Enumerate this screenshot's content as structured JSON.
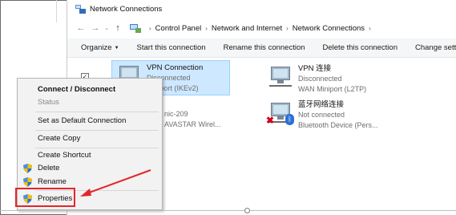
{
  "window": {
    "title": "Network Connections"
  },
  "address_bar": {
    "crumbs": [
      "Control Panel",
      "Network and Internet",
      "Network Connections"
    ]
  },
  "toolbar": {
    "organize": "Organize",
    "start": "Start this connection",
    "rename": "Rename this connection",
    "delete": "Delete this connection",
    "change": "Change settings"
  },
  "connections": [
    {
      "name": "VPN Connection",
      "status": "Disconnected",
      "device": "Miniport (IKEv2)"
    },
    {
      "name": "VPN 连接",
      "status": "Disconnected",
      "device": "WAN Miniport (L2TP)"
    },
    {
      "name": "",
      "status": "nic-209",
      "device": "AVASTAR Wirel..."
    },
    {
      "name": "蓝牙网络连接",
      "status": "Not connected",
      "device": "Bluetooth Device (Pers..."
    }
  ],
  "context_menu": {
    "items": [
      "Connect / Disconnect",
      "Status",
      "Set as Default Connection",
      "Create Copy",
      "Create Shortcut",
      "Delete",
      "Rename",
      "Properties"
    ]
  },
  "colors": {
    "selection_bg": "#cde8ff",
    "annotation_red": "#e3262b",
    "shield_blue": "#2a6fd6",
    "shield_yellow": "#f2c200"
  }
}
